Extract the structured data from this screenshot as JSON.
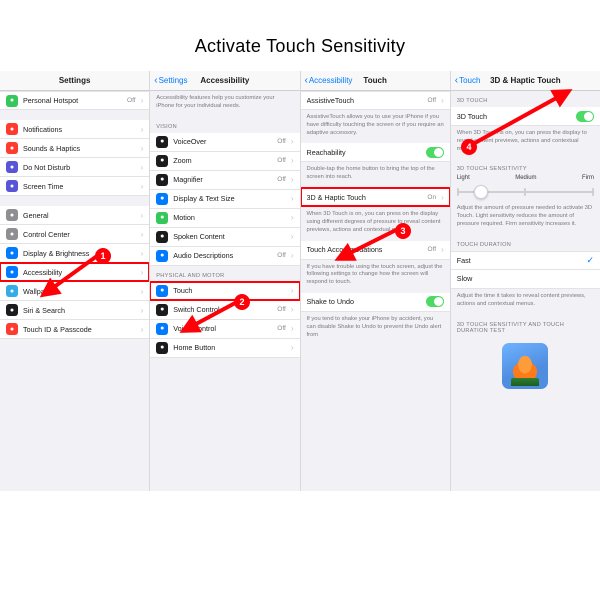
{
  "title": "Activate Touch Sensitivity",
  "steps": [
    "1",
    "2",
    "3",
    "4"
  ],
  "panel1": {
    "header": "Settings",
    "rows": [
      {
        "icon": "hotspot",
        "color": "c-green",
        "label": "Personal Hotspot",
        "val": "Off",
        "disc": true
      },
      {
        "gap": true
      },
      {
        "icon": "bell",
        "color": "c-red",
        "label": "Notifications",
        "disc": true
      },
      {
        "icon": "speaker",
        "color": "c-red",
        "label": "Sounds & Haptics",
        "disc": true
      },
      {
        "icon": "moon",
        "color": "c-purple",
        "label": "Do Not Disturb",
        "disc": true
      },
      {
        "icon": "hourglass",
        "color": "c-purple",
        "label": "Screen Time",
        "disc": true
      },
      {
        "gap": true
      },
      {
        "icon": "gear",
        "color": "c-grey",
        "label": "General",
        "disc": true
      },
      {
        "icon": "switches",
        "color": "c-grey",
        "label": "Control Center",
        "disc": true
      },
      {
        "icon": "aa",
        "color": "c-blue",
        "label": "Display & Brightness",
        "disc": true
      },
      {
        "icon": "person",
        "color": "c-blue",
        "label": "Accessibility",
        "disc": true,
        "highlighted": true
      },
      {
        "icon": "flower",
        "color": "c-teal",
        "label": "Wallpaper",
        "disc": true
      },
      {
        "icon": "siri",
        "color": "c-black",
        "label": "Siri & Search",
        "disc": true
      },
      {
        "icon": "touchid",
        "color": "c-red",
        "label": "Touch ID & Passcode",
        "disc": true
      }
    ]
  },
  "panel2": {
    "back": "Settings",
    "header": "Accessibility",
    "desc": "Accessibility features help you customize your iPhone for your individual needs.",
    "groups": [
      {
        "title": "VISION",
        "rows": [
          {
            "icon": "vo",
            "color": "c-black",
            "label": "VoiceOver",
            "val": "Off",
            "disc": true
          },
          {
            "icon": "zoom",
            "color": "c-black",
            "label": "Zoom",
            "val": "Off",
            "disc": true
          },
          {
            "icon": "mag",
            "color": "c-black",
            "label": "Magnifier",
            "val": "Off",
            "disc": true
          },
          {
            "icon": "aa",
            "color": "c-blue",
            "label": "Display & Text Size",
            "disc": true
          },
          {
            "icon": "motion",
            "color": "c-green",
            "label": "Motion",
            "disc": true
          },
          {
            "icon": "speak",
            "color": "c-black",
            "label": "Spoken Content",
            "disc": true
          },
          {
            "icon": "ad",
            "color": "c-blue",
            "label": "Audio Descriptions",
            "val": "Off",
            "disc": true
          }
        ]
      },
      {
        "title": "PHYSICAL AND MOTOR",
        "rows": [
          {
            "icon": "touch",
            "color": "c-blue",
            "label": "Touch",
            "disc": true,
            "highlighted": true
          },
          {
            "icon": "switch",
            "color": "c-black",
            "label": "Switch Control",
            "val": "Off",
            "disc": true
          },
          {
            "icon": "voice",
            "color": "c-blue",
            "label": "Voice Control",
            "val": "Off",
            "disc": true
          },
          {
            "icon": "home",
            "color": "c-black",
            "label": "Home Button",
            "disc": true
          }
        ]
      }
    ]
  },
  "panel3": {
    "back": "Accessibility",
    "header": "Touch",
    "blocks": [
      {
        "row": {
          "label": "AssistiveTouch",
          "val": "Off",
          "disc": true
        }
      },
      {
        "desc": "AssistiveTouch allows you to use your iPhone if you have difficulty touching the screen or if you require an adaptive accessory."
      },
      {
        "row": {
          "label": "Reachability",
          "toggle": true
        }
      },
      {
        "desc": "Double-tap the home button to bring the top of the screen into reach."
      },
      {
        "row": {
          "label": "3D & Haptic Touch",
          "val": "On",
          "disc": true,
          "highlighted": true
        }
      },
      {
        "desc": "When 3D Touch is on, you can press on the display using different degrees of pressure to reveal content previews, actions and contextual menus."
      },
      {
        "row": {
          "label": "Touch Accommodations",
          "val": "Off",
          "disc": true
        }
      },
      {
        "desc": "If you have trouble using the touch screen, adjust the following settings to change how the screen will respond to touch."
      },
      {
        "row": {
          "label": "Shake to Undo",
          "toggle": true
        }
      },
      {
        "desc": "If you tend to shake your iPhone by accident, you can disable Shake to Undo to prevent the Undo alert from"
      }
    ]
  },
  "panel4": {
    "back": "Touch",
    "header": "3D & Haptic Touch",
    "sh1": "3D TOUCH",
    "row1": {
      "label": "3D Touch",
      "toggle": true
    },
    "desc1": "When 3D Touch is on, you can press the display to reveal content previews, actions and contextual menus.",
    "sh2": "3D TOUCH SENSITIVITY",
    "seg": [
      "Light",
      "Medium",
      "Firm"
    ],
    "desc2": "Adjust the amount of pressure needed to activate 3D Touch. Light sensitivity reduces the amount of pressure required. Firm sensitivity increases it.",
    "sh3": "TOUCH DURATION",
    "dur": [
      {
        "label": "Fast",
        "checked": true
      },
      {
        "label": "Slow"
      }
    ],
    "desc3": "Adjust the time it takes to reveal content previews, actions and contextual menus.",
    "sh4": "3D TOUCH SENSITIVITY AND TOUCH DURATION TEST"
  }
}
